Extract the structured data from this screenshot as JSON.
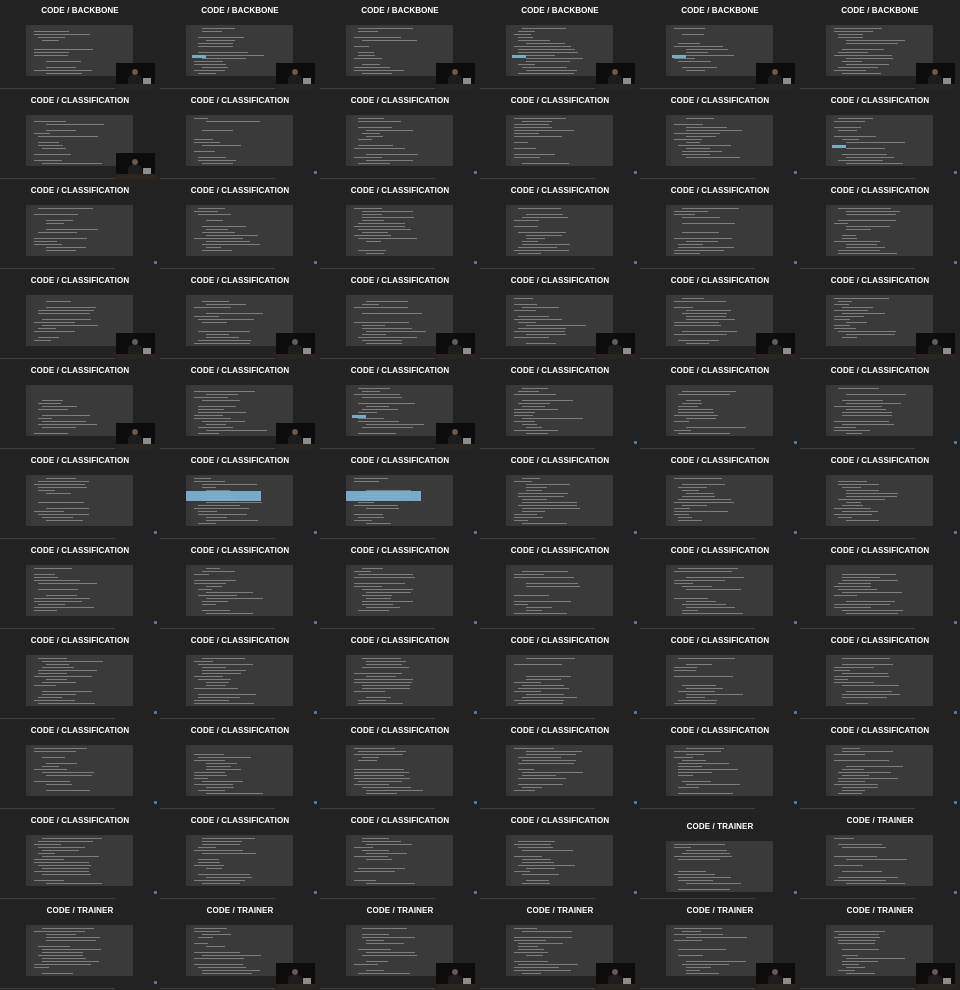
{
  "grid": {
    "columns": 6,
    "rows": 11,
    "frames": [
      [
        "CODE / BACKBONE",
        "CODE / BACKBONE",
        "CODE / BACKBONE",
        "CODE / BACKBONE",
        "CODE / BACKBONE",
        "CODE / BACKBONE"
      ],
      [
        "CODE / CLASSIFICATION",
        "CODE / CLASSIFICATION",
        "CODE / CLASSIFICATION",
        "CODE / CLASSIFICATION",
        "CODE / CLASSIFICATION",
        "CODE / CLASSIFICATION"
      ],
      [
        "CODE / CLASSIFICATION",
        "CODE / CLASSIFICATION",
        "CODE / CLASSIFICATION",
        "CODE / CLASSIFICATION",
        "CODE / CLASSIFICATION",
        "CODE / CLASSIFICATION"
      ],
      [
        "CODE / CLASSIFICATION",
        "CODE / CLASSIFICATION",
        "CODE / CLASSIFICATION",
        "CODE / CLASSIFICATION",
        "CODE / CLASSIFICATION",
        "CODE / CLASSIFICATION"
      ],
      [
        "CODE / CLASSIFICATION",
        "CODE / CLASSIFICATION",
        "CODE / CLASSIFICATION",
        "CODE / CLASSIFICATION",
        "CODE / CLASSIFICATION",
        "CODE / CLASSIFICATION"
      ],
      [
        "CODE / CLASSIFICATION",
        "CODE / CLASSIFICATION",
        "CODE / CLASSIFICATION",
        "CODE / CLASSIFICATION",
        "CODE / CLASSIFICATION",
        "CODE / CLASSIFICATION"
      ],
      [
        "CODE / CLASSIFICATION",
        "CODE / CLASSIFICATION",
        "CODE / CLASSIFICATION",
        "CODE / CLASSIFICATION",
        "CODE / CLASSIFICATION",
        "CODE / CLASSIFICATION"
      ],
      [
        "CODE / CLASSIFICATION",
        "CODE / CLASSIFICATION",
        "CODE / CLASSIFICATION",
        "CODE / CLASSIFICATION",
        "CODE / CLASSIFICATION",
        "CODE / CLASSIFICATION"
      ],
      [
        "CODE / CLASSIFICATION",
        "CODE / CLASSIFICATION",
        "CODE / CLASSIFICATION",
        "CODE / CLASSIFICATION",
        "CODE / CLASSIFICATION",
        "CODE / CLASSIFICATION"
      ],
      [
        "CODE / CLASSIFICATION",
        "CODE / CLASSIFICATION",
        "CODE / CLASSIFICATION",
        "CODE / CLASSIFICATION",
        "CODE / TRAINER",
        "CODE / TRAINER"
      ],
      [
        "CODE / TRAINER",
        "CODE / TRAINER",
        "CODE / TRAINER",
        "CODE / TRAINER",
        "CODE / TRAINER",
        "CODE / TRAINER"
      ]
    ],
    "webcam_visible": [
      [
        true,
        true,
        true,
        true,
        true,
        true
      ],
      [
        true,
        false,
        false,
        false,
        false,
        false
      ],
      [
        false,
        false,
        false,
        false,
        false,
        false
      ],
      [
        true,
        true,
        true,
        true,
        true,
        true
      ],
      [
        true,
        true,
        true,
        false,
        false,
        false
      ],
      [
        false,
        false,
        false,
        false,
        false,
        false
      ],
      [
        false,
        false,
        false,
        false,
        false,
        false
      ],
      [
        false,
        false,
        false,
        false,
        false,
        false
      ],
      [
        false,
        false,
        false,
        false,
        false,
        false
      ],
      [
        false,
        false,
        false,
        false,
        false,
        false
      ],
      [
        false,
        true,
        true,
        true,
        true,
        true
      ]
    ]
  },
  "colors": {
    "background": "#222222",
    "code_panel": "#3a3a3a",
    "title_text": "#ffffff",
    "selection_highlight": "#7fb8d8"
  }
}
